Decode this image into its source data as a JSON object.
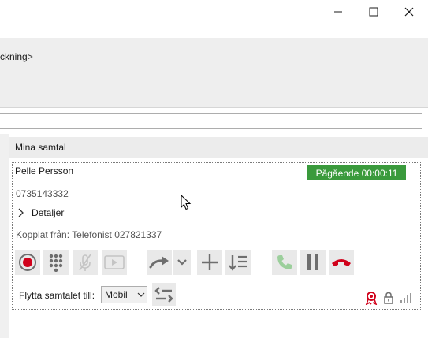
{
  "window": {
    "controls": [
      "minimize-icon",
      "maximize-icon",
      "close-icon"
    ]
  },
  "header": {
    "text": "ckning>"
  },
  "search": {
    "value": "",
    "placeholder": ""
  },
  "section": {
    "title": "Mina samtal"
  },
  "call": {
    "name": "Pelle Persson",
    "status_text": "Pågående 00:00:11",
    "number": "0735143332",
    "details_label": "Detaljer",
    "connected_from": "Kopplat från: Telefonist 027821337"
  },
  "toolbar": {
    "buttons": [
      {
        "name": "record-icon",
        "enabled": true
      },
      {
        "name": "keypad-icon",
        "enabled": true
      },
      {
        "name": "mute-icon",
        "enabled": false
      },
      {
        "name": "video-icon",
        "enabled": false
      },
      {
        "name": "forward-icon",
        "enabled": true
      },
      {
        "name": "chevron-down-icon",
        "enabled": true
      },
      {
        "name": "add-call-icon",
        "enabled": true
      },
      {
        "name": "queue-list-icon",
        "enabled": true
      },
      {
        "name": "answer-icon",
        "enabled": false
      },
      {
        "name": "hold-icon",
        "enabled": true
      },
      {
        "name": "hangup-icon",
        "enabled": true
      }
    ]
  },
  "move_call": {
    "label": "Flytta samtalet till:",
    "selected": "Mobil"
  },
  "colors": {
    "status_green": "#3a9a3c",
    "hangup_red": "#d0021b",
    "answer_green_disabled": "#9ccf9c",
    "record_red": "#d0021b",
    "icon_gray": "#6e6e6e"
  }
}
